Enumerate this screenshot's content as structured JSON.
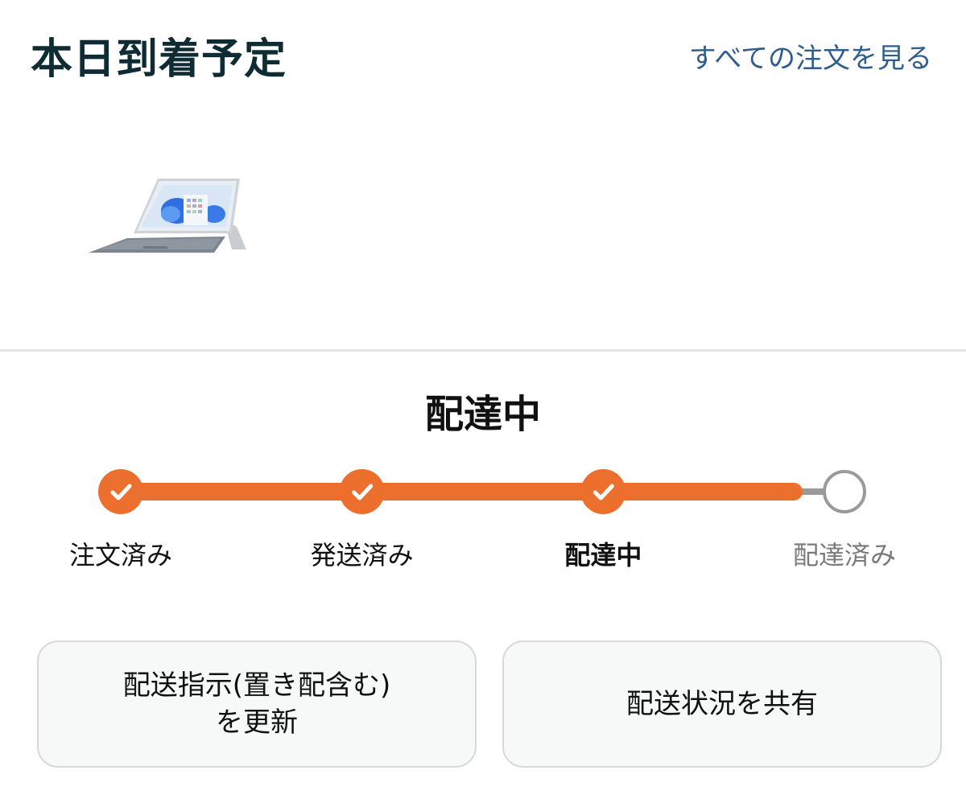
{
  "header": {
    "title": "本日到着予定",
    "see_all_link": "すべての注文を見る"
  },
  "product": {
    "image_icon": "tablet-with-keyboard-image"
  },
  "status": {
    "heading": "配達中"
  },
  "tracker": {
    "progress_fraction": 0.93,
    "colors": {
      "active": "#ec6f2d",
      "pending": "#9a9a9a"
    },
    "steps": [
      {
        "label": "注文済み",
        "state": "done"
      },
      {
        "label": "発送済み",
        "state": "done"
      },
      {
        "label": "配達中",
        "state": "current"
      },
      {
        "label": "配達済み",
        "state": "pending"
      }
    ]
  },
  "actions": {
    "update_instructions_line1": "配送指示(置き配含む)",
    "update_instructions_line2": "を更新",
    "share_status": "配送状況を共有"
  }
}
